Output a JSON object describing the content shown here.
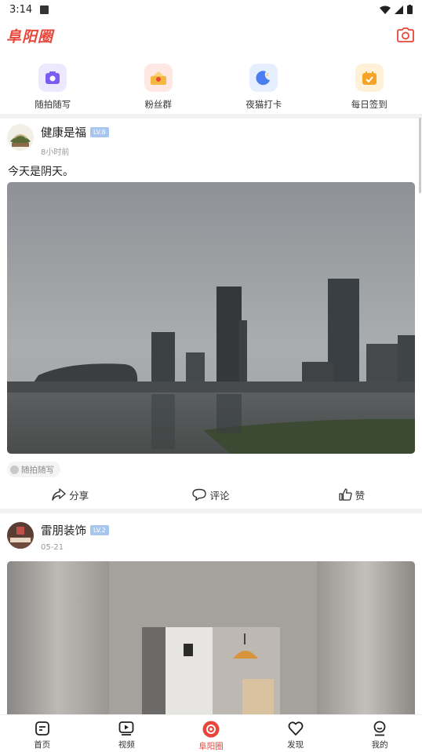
{
  "status_bar": {
    "time": "3:14"
  },
  "header": {
    "logo": "阜阳圈",
    "accent_color": "#e8463a",
    "camera_icon": "camera-icon"
  },
  "quick_actions": [
    {
      "label": "随拍随写",
      "icon": "camera-icon",
      "bg": "#ece9ff"
    },
    {
      "label": "粉丝群",
      "icon": "fans-group-icon",
      "bg": "#ffe8e3"
    },
    {
      "label": "夜猫打卡",
      "icon": "moon-icon",
      "bg": "#e6efff"
    },
    {
      "label": "每日签到",
      "icon": "calendar-icon",
      "bg": "#fff1d8"
    }
  ],
  "posts": [
    {
      "author": "健康是福",
      "level": "LV.8",
      "time": "8小时前",
      "text": "今天是阴天。",
      "tag": "随拍随写",
      "actions": {
        "share": "分享",
        "comment": "评论",
        "like": "赞"
      }
    },
    {
      "author": "雷朋装饰",
      "level": "LV.2",
      "time": "05-21"
    }
  ],
  "tabbar": [
    {
      "label": "首页",
      "icon": "home-icon"
    },
    {
      "label": "视频",
      "icon": "video-icon"
    },
    {
      "label": "阜阳圈",
      "icon": "circle-icon",
      "active": true
    },
    {
      "label": "发现",
      "icon": "discover-icon"
    },
    {
      "label": "我的",
      "icon": "profile-icon"
    }
  ]
}
